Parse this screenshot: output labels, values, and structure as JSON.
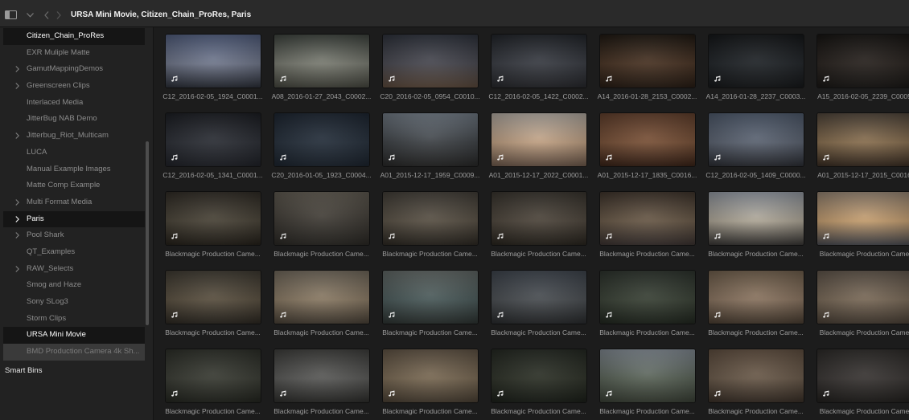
{
  "toolbar": {
    "icons": [
      "sidebar-toggle-icon",
      "chevron-down-icon",
      "chevron-left-icon",
      "chevron-right-icon"
    ],
    "title": "URSA Mini Movie, Citizen_Chain_ProRes, Paris"
  },
  "bins": [
    {
      "label": "Citizen_Chain_ProRes",
      "selected": true
    },
    {
      "label": "EXR Muliple Matte"
    },
    {
      "label": "GamutMappingDemos",
      "expandable": true
    },
    {
      "label": "Greenscreen Clips",
      "expandable": true
    },
    {
      "label": "Interlaced Media"
    },
    {
      "label": "JitterBug NAB Demo"
    },
    {
      "label": "Jitterbug_Riot_Multicam",
      "expandable": true
    },
    {
      "label": "LUCA"
    },
    {
      "label": "Manual Example Images"
    },
    {
      "label": "Matte Comp Example"
    },
    {
      "label": "Multi Format Media",
      "expandable": true
    },
    {
      "label": "Paris",
      "expandable": true,
      "selected": true
    },
    {
      "label": "Pool Shark",
      "expandable": true
    },
    {
      "label": "QT_Examples"
    },
    {
      "label": "RAW_Selects",
      "expandable": true
    },
    {
      "label": "Smog and Haze"
    },
    {
      "label": "Sony SLog3"
    },
    {
      "label": "Storm Clips"
    },
    {
      "label": "URSA Mini Movie",
      "selected": true
    },
    {
      "label": "BMD Production Camera 4k Sh...",
      "highlighted": true
    }
  ],
  "smart_bins": {
    "label": "Smart Bins"
  },
  "clip_badge_icon": "music-note-icon",
  "clips": [
    {
      "name": "C12_2016-02-05_1924_C0001...",
      "colors": [
        "#4c5876",
        "#737a8e",
        "#2c3039"
      ]
    },
    {
      "name": "A08_2016-01-27_2043_C0002...",
      "colors": [
        "#3a3f3a",
        "#7c7e74",
        "#46473f"
      ]
    },
    {
      "name": "C20_2016-02-05_0954_C0010...",
      "colors": [
        "#2b2f38",
        "#4a4a52",
        "#5c4a3c"
      ]
    },
    {
      "name": "C12_2016-02-05_1422_C0002...",
      "colors": [
        "#1f2227",
        "#3b3e45",
        "#28292d"
      ]
    },
    {
      "name": "A14_2016-01-28_2153_C0002...",
      "colors": [
        "#1d1711",
        "#4b3525",
        "#281d15"
      ]
    },
    {
      "name": "A14_2016-01-28_2237_C0003...",
      "colors": [
        "#131517",
        "#22262a",
        "#17191b"
      ]
    },
    {
      "name": "A15_2016-02-05_2239_C0005",
      "colors": [
        "#151311",
        "#2a2420",
        "#1a1816"
      ]
    },
    {
      "name": "C12_2016-02-05_1341_C0001...",
      "colors": [
        "#1a1c21",
        "#2d3037",
        "#212329"
      ]
    },
    {
      "name": "C20_2016-01-05_1923_C0004...",
      "colors": [
        "#1b232e",
        "#27313d",
        "#1d252f"
      ]
    },
    {
      "name": "A01_2015-12-17_1959_C0009...",
      "colors": [
        "#6b747e",
        "#3f4347",
        "#292929"
      ]
    },
    {
      "name": "A01_2015-12-17_2022_C0001...",
      "colors": [
        "#a8a199",
        "#c3a385",
        "#6d594b"
      ]
    },
    {
      "name": "A01_2015-12-17_1835_C0016...",
      "colors": [
        "#5b3b29",
        "#7b5339",
        "#392318"
      ]
    },
    {
      "name": "C12_2016-02-05_1409_C0000...",
      "colors": [
        "#4a5566",
        "#5d6573",
        "#2d2f35"
      ]
    },
    {
      "name": "A01_2015-12-17_2015_C0016",
      "colors": [
        "#4a4036",
        "#8b7151",
        "#392d23"
      ]
    },
    {
      "name": "Blackmagic Production Came...",
      "colors": [
        "#2d2923",
        "#4b4539",
        "#25211b"
      ]
    },
    {
      "name": "Blackmagic Production Came...",
      "colors": [
        "#5a554c",
        "#3f3b35",
        "#2b2925"
      ]
    },
    {
      "name": "Blackmagic Production Came...",
      "colors": [
        "#3e3a34",
        "#5a5246",
        "#2d2923"
      ]
    },
    {
      "name": "Blackmagic Production Came...",
      "colors": [
        "#35312b",
        "#4f473d",
        "#29251f"
      ]
    },
    {
      "name": "Blackmagic Production Came...",
      "colors": [
        "#3b3129",
        "#6b5b49",
        "#3b3331"
      ]
    },
    {
      "name": "Blackmagic Production Came...",
      "colors": [
        "#8a9099",
        "#b1a999",
        "#393735"
      ]
    },
    {
      "name": "Blackmagic Production Came",
      "colors": [
        "#8b7b6b",
        "#c7a071",
        "#494a50"
      ]
    },
    {
      "name": "Blackmagic Production Came...",
      "colors": [
        "#3a362e",
        "#5b5141",
        "#2d2923"
      ]
    },
    {
      "name": "Blackmagic Production Came...",
      "colors": [
        "#6a6256",
        "#8b7b65",
        "#494137"
      ]
    },
    {
      "name": "Blackmagic Production Came...",
      "colors": [
        "#5b615f",
        "#4b5b5b",
        "#2e3432"
      ]
    },
    {
      "name": "Blackmagic Production Came...",
      "colors": [
        "#3a4048",
        "#4b4f53",
        "#2a2c2e"
      ]
    },
    {
      "name": "Blackmagic Production Came...",
      "colors": [
        "#2a302a",
        "#3b4337",
        "#222820"
      ]
    },
    {
      "name": "Blackmagic Production Came...",
      "colors": [
        "#6a5a48",
        "#8b7561",
        "#4a3e32"
      ]
    },
    {
      "name": "Blackmagic Production Came",
      "colors": [
        "#5a5046",
        "#7b6b59",
        "#4a4036"
      ]
    },
    {
      "name": "Blackmagic Production Came...",
      "colors": [
        "#2a2c26",
        "#3b3d35",
        "#242620"
      ]
    },
    {
      "name": "Blackmagic Production Came...",
      "colors": [
        "#3a3a38",
        "#5b5b59",
        "#2e2e2c"
      ]
    },
    {
      "name": "Blackmagic Production Came...",
      "colors": [
        "#5a4e40",
        "#7b6b55",
        "#4a4034"
      ]
    },
    {
      "name": "Blackmagic Production Came...",
      "colors": [
        "#222620",
        "#2f3329",
        "#1c201a"
      ]
    },
    {
      "name": "Blackmagic Production Came...",
      "colors": [
        "#7b838b",
        "#5b6559",
        "#3a4036"
      ]
    },
    {
      "name": "Blackmagic Production Came...",
      "colors": [
        "#5a4a3c",
        "#6b5b4b",
        "#3a3028"
      ]
    },
    {
      "name": "Blackmagic Production Came",
      "colors": [
        "#2a2826",
        "#3b3735",
        "#22201e"
      ]
    }
  ]
}
